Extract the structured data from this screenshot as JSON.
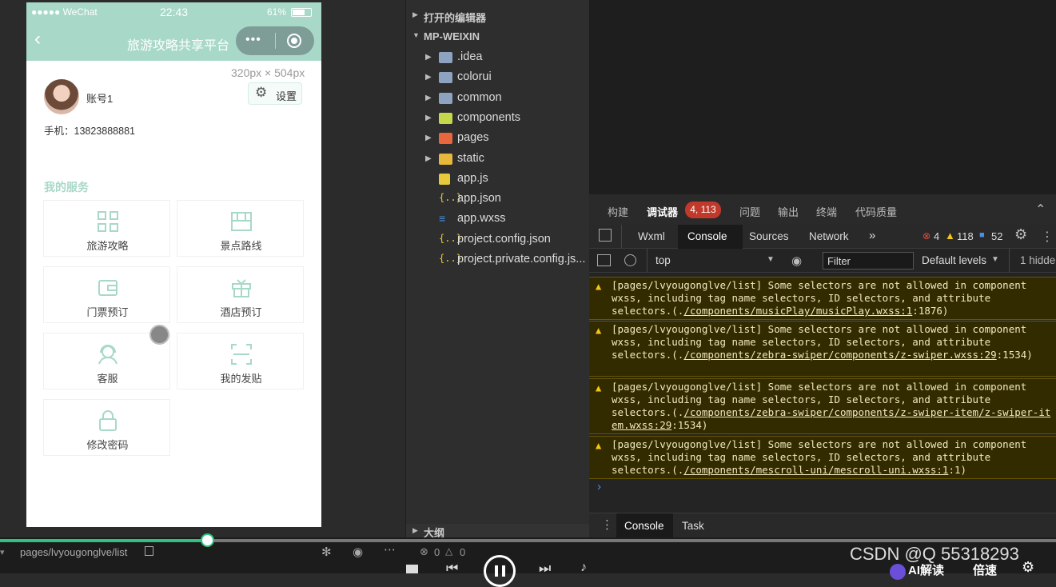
{
  "phone": {
    "carrier": "●●●●● WeChat",
    "time": "22:43",
    "battery": "61%",
    "nav_title": "旅游攻略共享平台",
    "size_tag": "320px × 504px",
    "username": "账号1",
    "phone_label": "手机：13823888881",
    "settings_label": "设置",
    "section_title": "我的服务",
    "services": [
      {
        "label": "旅游攻略",
        "icon": "grid-icon"
      },
      {
        "label": "景点路线",
        "icon": "map-icon"
      },
      {
        "label": "门票预订",
        "icon": "wallet-icon"
      },
      {
        "label": "酒店预订",
        "icon": "gift-icon"
      },
      {
        "label": "客服",
        "icon": "headset-icon"
      },
      {
        "label": "我的发贴",
        "icon": "scan-icon"
      },
      {
        "label": "修改密码",
        "icon": "lock-icon"
      }
    ]
  },
  "explorer": {
    "open_editors": "打开的编辑器",
    "project": "MP-WEIXIN",
    "items": [
      {
        "name": ".idea",
        "type": "folder",
        "color": "#8ea3c0"
      },
      {
        "name": "colorui",
        "type": "folder",
        "color": "#8ea3c0"
      },
      {
        "name": "common",
        "type": "folder",
        "color": "#8ea3c0"
      },
      {
        "name": "components",
        "type": "folder",
        "color": "#c5d84b"
      },
      {
        "name": "pages",
        "type": "folder",
        "color": "#e8673c"
      },
      {
        "name": "static",
        "type": "folder",
        "color": "#e8b83c"
      },
      {
        "name": "app.js",
        "type": "js",
        "color": "#e8c93c"
      },
      {
        "name": "app.json",
        "type": "json",
        "color": "#e8c93c"
      },
      {
        "name": "app.wxss",
        "type": "css",
        "color": "#4a90e2"
      },
      {
        "name": "project.config.json",
        "type": "json",
        "color": "#e8c93c"
      },
      {
        "name": "project.private.config.js...",
        "type": "json",
        "color": "#e8c93c"
      }
    ],
    "outline": "大纲"
  },
  "devtools": {
    "top_tabs": [
      "构建",
      "调试器",
      "问题",
      "输出",
      "终端",
      "代码质量"
    ],
    "active_top_tab": "调试器",
    "badge": "4, 113",
    "panel_tabs": [
      "Wxml",
      "Console",
      "Sources",
      "Network"
    ],
    "active_panel_tab": "Console",
    "more": "»",
    "error_count": "4",
    "warn_count": "118",
    "info_count": "52",
    "context": "top",
    "filter_placeholder": "Filter",
    "levels": "Default levels",
    "hidden": "1 hidde",
    "logs": [
      {
        "line1": "[pages/lvyougonglve/list] Some selectors are not allowed in component",
        "line2": "wxss, including tag name selectors, ID selectors, and attribute",
        "pre": "selectors.(.",
        "link": "/components/musicPlay/musicPlay.wxss:1",
        "post": ":1876)"
      },
      {
        "line1": "[pages/lvyougonglve/list] Some selectors are not allowed in component",
        "line2": "wxss, including tag name selectors, ID selectors, and attribute",
        "pre": "selectors.(.",
        "link": "/components/zebra-swiper/components/z-swiper.wxss:29",
        "post": ":1534)"
      },
      {
        "line1": "[pages/lvyougonglve/list] Some selectors are not allowed in component",
        "line2": "wxss, including tag name selectors, ID selectors, and attribute",
        "pre": "selectors.(.",
        "link": "/components/zebra-swiper/components/z-swiper-item/z-swiper-item.wxss:29",
        "post": ":1534)"
      },
      {
        "line1": "[pages/lvyougonglve/list] Some selectors are not allowed in component",
        "line2": "wxss, including tag name selectors, ID selectors, and attribute",
        "pre": "selectors.(.",
        "link": "/components/mescroll-uni/mescroll-uni.wxss:1",
        "post": ":1)"
      }
    ],
    "prompt": "›",
    "drawer_tabs": [
      "Console",
      "Task"
    ]
  },
  "bottom": {
    "page_path": "pages/lvyougonglve/list",
    "errors": "0",
    "warnings": "0",
    "watermark": "CSDN @Q 55318293",
    "ai_label": "AI解读",
    "speed_label": "倍速",
    "progress": 0.196
  }
}
